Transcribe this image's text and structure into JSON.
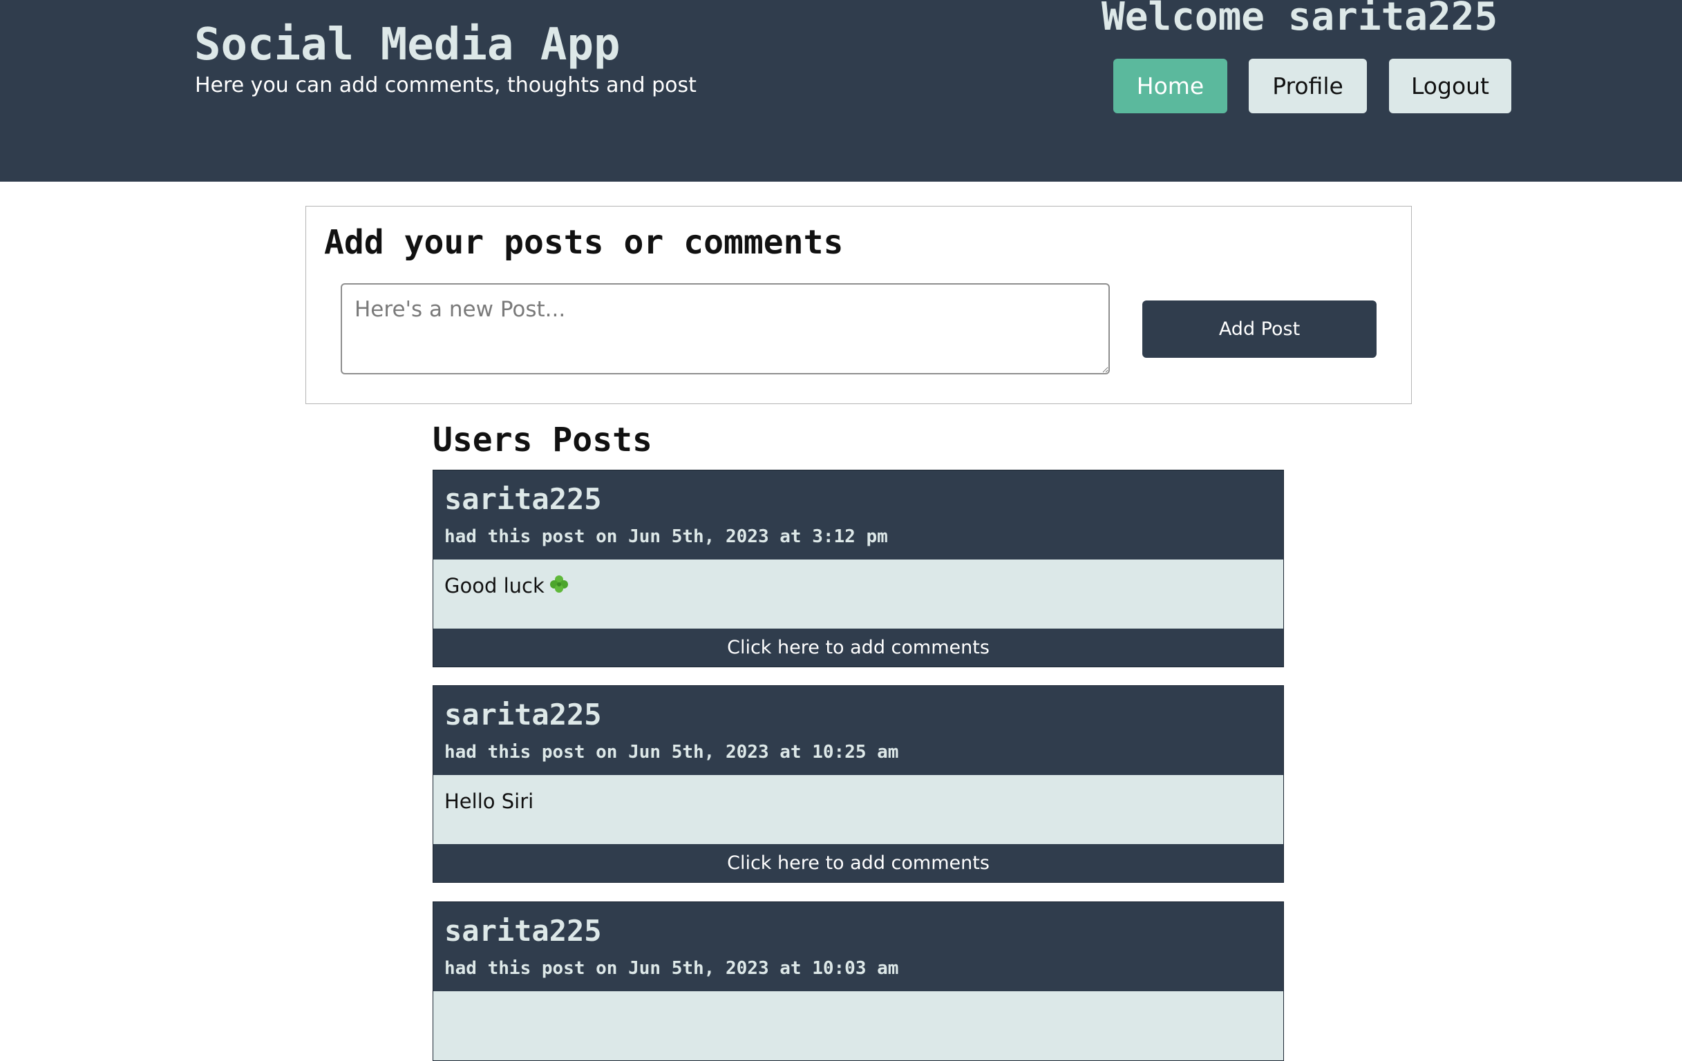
{
  "header": {
    "title": "Social Media App",
    "subtitle": "Here you can add comments, thoughts and post",
    "welcome": "Welcome sarita225",
    "nav": {
      "home": "Home",
      "profile": "Profile",
      "logout": "Logout"
    }
  },
  "add_post": {
    "heading": "Add your posts or comments",
    "placeholder": "Here's a new Post...",
    "value": "",
    "button_label": "Add Post"
  },
  "users_posts": {
    "heading": "Users Posts",
    "posts": [
      {
        "username": "sarita225",
        "meta": "had this post on Jun 5th, 2023 at 3:12 pm",
        "content": "Good luck",
        "icon": "four-leaf-clover-icon",
        "comment_label": "Click here to add comments"
      },
      {
        "username": "sarita225",
        "meta": "had this post on Jun 5th, 2023 at 10:25 am",
        "content": "Hello Siri",
        "comment_label": "Click here to add comments"
      },
      {
        "username": "sarita225",
        "meta": "had this post on Jun 5th, 2023 at 10:03 am",
        "content": "",
        "comment_label": ""
      }
    ]
  },
  "colors": {
    "header_bg": "#303d4d",
    "accent_green": "#5bb99d",
    "light_panel": "#dce8e8",
    "header_text": "#dde8e8"
  }
}
